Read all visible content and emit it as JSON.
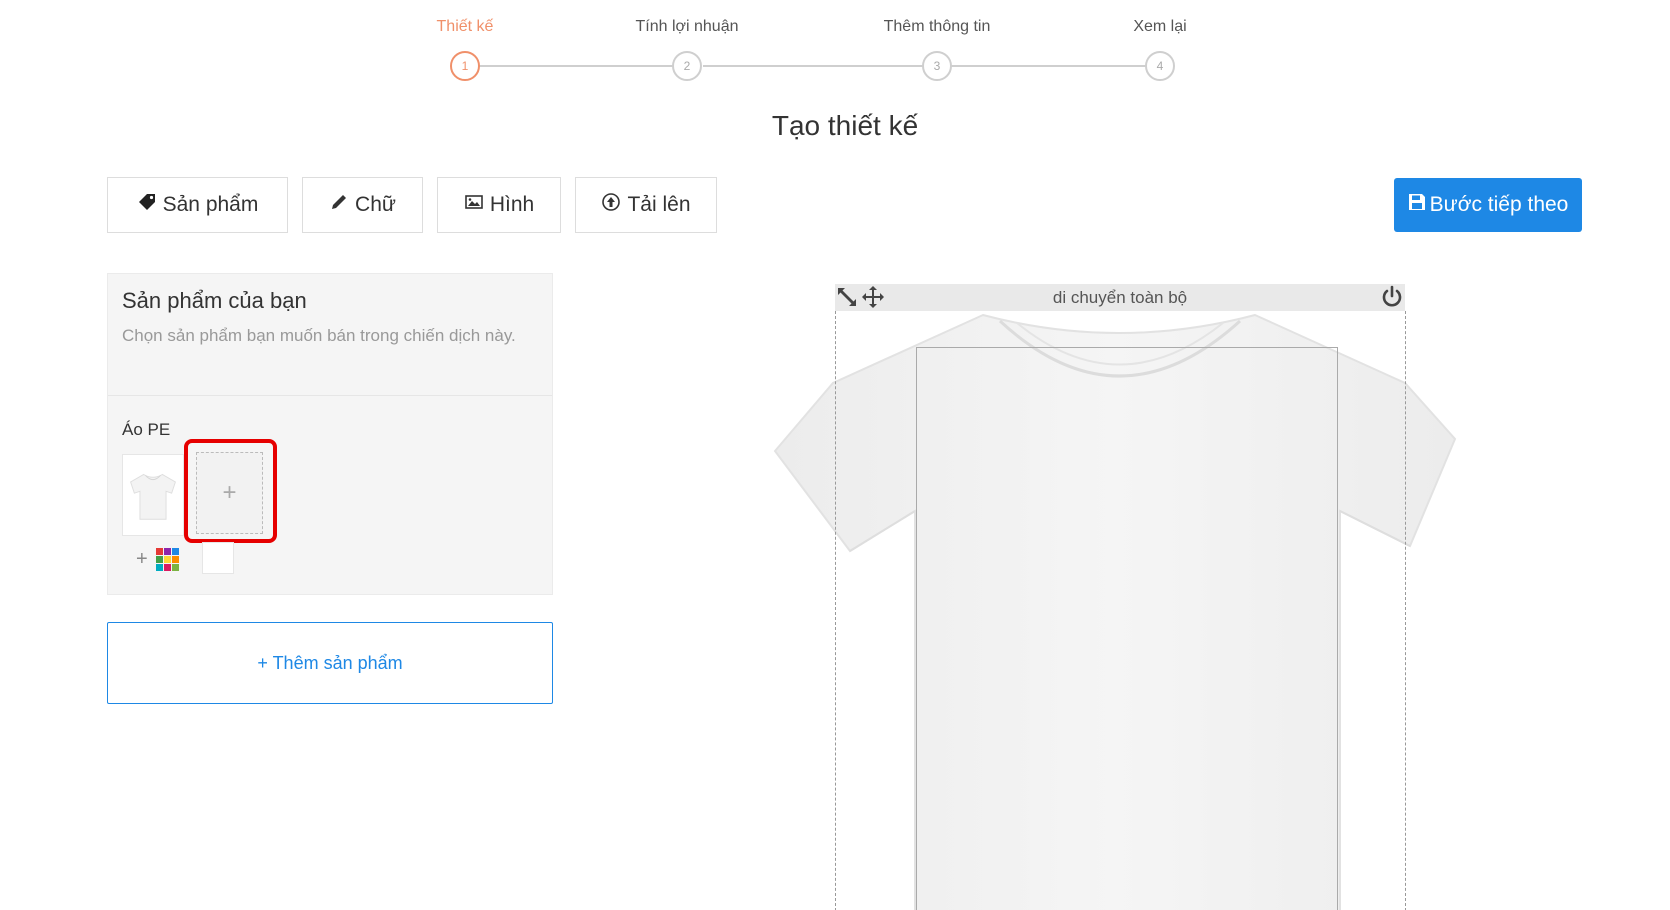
{
  "stepper": {
    "steps": [
      {
        "label": "Thiết kế",
        "number": "1",
        "active": true
      },
      {
        "label": "Tính lợi nhuận",
        "number": "2",
        "active": false
      },
      {
        "label": "Thêm thông tin",
        "number": "3",
        "active": false
      },
      {
        "label": "Xem lại",
        "number": "4",
        "active": false
      }
    ]
  },
  "page": {
    "title": "Tạo thiết kế"
  },
  "toolbar": {
    "product_label": "Sản phẩm",
    "text_label": "Chữ",
    "image_label": "Hình",
    "upload_label": "Tải lên",
    "next_label": "Bước tiếp theo"
  },
  "colors": {
    "accent": "#1e88e5",
    "active_step": "#f0906a",
    "highlight": "#e60000"
  },
  "panel": {
    "title": "Sản phẩm của bạn",
    "subtitle": "Chọn sản phẩm bạn muốn bán trong chiến dịch này.",
    "product_name": "Áo PE",
    "add_slot_symbol": "+",
    "add_color_symbol": "+",
    "add_product_label": "+ Thêm sản phẩm"
  },
  "canvas": {
    "move_all_label": "di chuyển toàn bộ"
  },
  "icons": [
    "tag-icon",
    "pencil-icon",
    "image-icon",
    "upload-icon",
    "save-icon",
    "resize-icon",
    "move-icon",
    "power-icon",
    "palette-icon"
  ]
}
